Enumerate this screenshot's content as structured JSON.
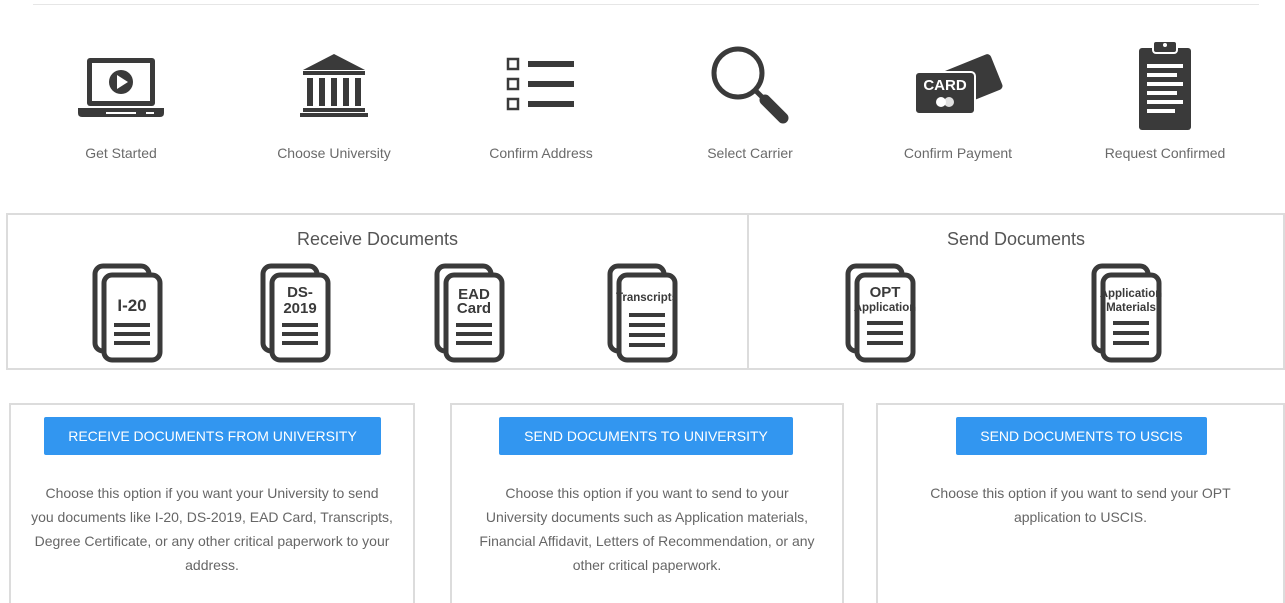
{
  "steps": [
    {
      "label": "Get Started",
      "icon": "laptop-play-icon"
    },
    {
      "label": "Choose University",
      "icon": "university-icon"
    },
    {
      "label": "Confirm Address",
      "icon": "checklist-icon"
    },
    {
      "label": "Select Carrier",
      "icon": "magnifier-icon"
    },
    {
      "label": "Confirm Payment",
      "icon": "payment-card-icon"
    },
    {
      "label": "Request Confirmed",
      "icon": "clipboard-icon"
    }
  ],
  "card_icon_text": "CARD",
  "receive": {
    "title": "Receive Documents",
    "docs": [
      {
        "line1": "I-20",
        "line2": ""
      },
      {
        "line1": "DS-",
        "line2": "2019"
      },
      {
        "line1": "EAD",
        "line2": "Card"
      },
      {
        "line1": "Transcripts",
        "line2": ""
      }
    ]
  },
  "send": {
    "title": "Send Documents",
    "docs": [
      {
        "line1": "OPT",
        "line2": "Application"
      },
      {
        "line1": "Application",
        "line2": "Materials"
      }
    ]
  },
  "options": [
    {
      "button": "RECEIVE DOCUMENTS FROM UNIVERSITY",
      "lines": [
        "Choose this option if you want your University to send",
        "you documents like I-20, DS-2019, EAD Card, Transcripts,",
        "Degree Certificate, or any other critical paperwork to your",
        "address."
      ]
    },
    {
      "button": "SEND DOCUMENTS TO UNIVERSITY",
      "lines": [
        "Choose this option if you want to send to your",
        "University documents such as Application materials,",
        "Financial Affidavit, Letters of Recommendation, or any",
        "other critical paperwork."
      ]
    },
    {
      "button": "SEND DOCUMENTS TO USCIS",
      "lines": [
        "Choose this option if you want to send your OPT",
        "application to USCIS."
      ]
    }
  ],
  "colors": {
    "icon": "#3a3a3a",
    "button": "#3296f0",
    "border": "#dcdcdc"
  }
}
